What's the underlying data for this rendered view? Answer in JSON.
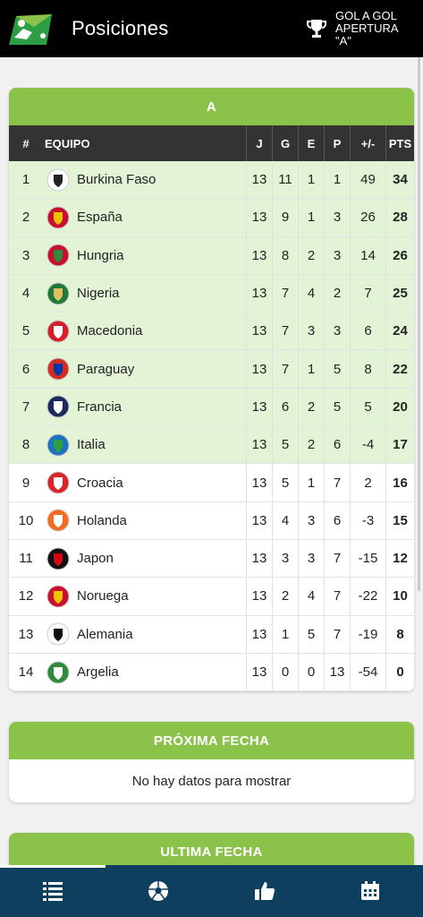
{
  "header": {
    "title": "Posiciones",
    "tournament": "GOL A GOL APERTURA \"A\""
  },
  "standings": {
    "group": "A",
    "columns": {
      "pos": "#",
      "team": "EQUIPO",
      "j": "J",
      "g": "G",
      "e": "E",
      "p": "P",
      "dif": "+/-",
      "pts": "PTS"
    },
    "rows": [
      {
        "pos": "1",
        "team": "Burkina Faso",
        "j": "13",
        "g": "11",
        "e": "1",
        "p": "1",
        "dif": "49",
        "pts": "34",
        "zone": "green",
        "crest_colors": [
          "#ffffff",
          "#222222"
        ]
      },
      {
        "pos": "2",
        "team": "España",
        "j": "13",
        "g": "9",
        "e": "1",
        "p": "3",
        "dif": "26",
        "pts": "28",
        "zone": "green",
        "crest_colors": [
          "#c8102e",
          "#f2c200"
        ]
      },
      {
        "pos": "3",
        "team": "Hungria",
        "j": "13",
        "g": "8",
        "e": "2",
        "p": "3",
        "dif": "14",
        "pts": "26",
        "zone": "green",
        "crest_colors": [
          "#c8102e",
          "#2e8b3c"
        ]
      },
      {
        "pos": "4",
        "team": "Nigeria",
        "j": "13",
        "g": "7",
        "e": "4",
        "p": "2",
        "dif": "7",
        "pts": "25",
        "zone": "green",
        "crest_colors": [
          "#1f7a3a",
          "#e0c060"
        ]
      },
      {
        "pos": "5",
        "team": "Macedonia",
        "j": "13",
        "g": "7",
        "e": "3",
        "p": "3",
        "dif": "6",
        "pts": "24",
        "zone": "green",
        "crest_colors": [
          "#d4202b",
          "#ffffff"
        ]
      },
      {
        "pos": "6",
        "team": "Paraguay",
        "j": "13",
        "g": "7",
        "e": "1",
        "p": "5",
        "dif": "8",
        "pts": "22",
        "zone": "green",
        "crest_colors": [
          "#d52b1e",
          "#0038a8"
        ]
      },
      {
        "pos": "7",
        "team": "Francia",
        "j": "13",
        "g": "6",
        "e": "2",
        "p": "5",
        "dif": "5",
        "pts": "20",
        "zone": "green",
        "crest_colors": [
          "#1b2a5a",
          "#ffffff"
        ]
      },
      {
        "pos": "8",
        "team": "Italia",
        "j": "13",
        "g": "5",
        "e": "2",
        "p": "6",
        "dif": "-4",
        "pts": "17",
        "zone": "green",
        "crest_colors": [
          "#1e73be",
          "#2e9e45"
        ]
      },
      {
        "pos": "9",
        "team": "Croacia",
        "j": "13",
        "g": "5",
        "e": "1",
        "p": "7",
        "dif": "2",
        "pts": "16",
        "zone": "white",
        "crest_colors": [
          "#d9252a",
          "#ffffff"
        ]
      },
      {
        "pos": "10",
        "team": "Holanda",
        "j": "13",
        "g": "4",
        "e": "3",
        "p": "6",
        "dif": "-3",
        "pts": "15",
        "zone": "white",
        "crest_colors": [
          "#f36c21",
          "#ffffff"
        ]
      },
      {
        "pos": "11",
        "team": "Japon",
        "j": "13",
        "g": "3",
        "e": "3",
        "p": "7",
        "dif": "-15",
        "pts": "12",
        "zone": "white",
        "crest_colors": [
          "#111111",
          "#d10a11"
        ]
      },
      {
        "pos": "12",
        "team": "Noruega",
        "j": "13",
        "g": "2",
        "e": "4",
        "p": "7",
        "dif": "-22",
        "pts": "10",
        "zone": "white",
        "crest_colors": [
          "#c8102e",
          "#f2c200"
        ]
      },
      {
        "pos": "13",
        "team": "Alemania",
        "j": "13",
        "g": "1",
        "e": "5",
        "p": "7",
        "dif": "-19",
        "pts": "8",
        "zone": "white",
        "crest_colors": [
          "#ffffff",
          "#111111"
        ]
      },
      {
        "pos": "14",
        "team": "Argelia",
        "j": "13",
        "g": "0",
        "e": "0",
        "p": "13",
        "dif": "-54",
        "pts": "0",
        "zone": "white",
        "crest_colors": [
          "#2e8b3c",
          "#ffffff"
        ]
      }
    ]
  },
  "next_round": {
    "title": "PRÓXIMA FECHA",
    "empty": "No hay datos para mostrar"
  },
  "last_round": {
    "title": "ULTIMA FECHA"
  },
  "bottom_nav": {
    "items": [
      {
        "icon": "standings-list-icon",
        "active": true
      },
      {
        "icon": "soccer-ball-icon",
        "active": false
      },
      {
        "icon": "thumbs-up-icon",
        "active": false
      },
      {
        "icon": "calendar-icon",
        "active": false
      }
    ]
  },
  "colors": {
    "accent_green": "#8bc34a",
    "table_head": "#333333",
    "row_highlight": "#e3f3d6",
    "nav_bg": "#0f3f5f"
  }
}
